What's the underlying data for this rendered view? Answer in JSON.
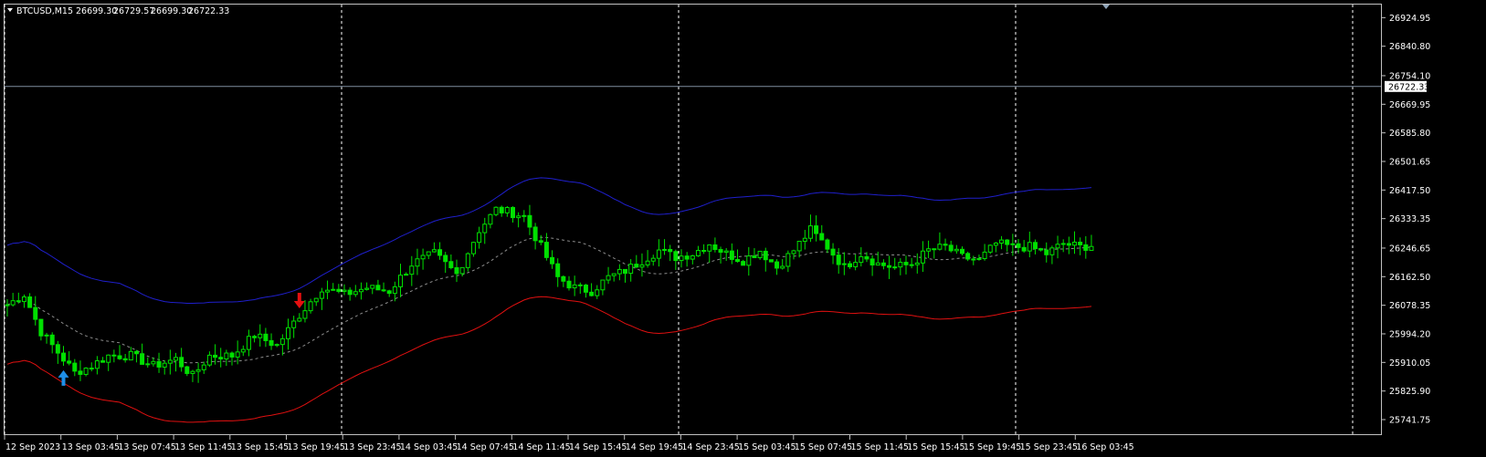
{
  "header": {
    "symbol": "BTCUSD,M15",
    "open": "26699.30",
    "high": "26729.57",
    "low": "26699.30",
    "close": "26722.33"
  },
  "colors": {
    "background": "#000000",
    "bull_candle": "#00e000",
    "bear_candle": "#00e000",
    "band_upper": "#1f1fcc",
    "band_middle": "#8c8c8c",
    "band_lower": "#e01010",
    "sell_arrow": "#e41010",
    "buy_arrow": "#1e8fe8",
    "price_line": "#7f8ea0",
    "grid": "#ffffff"
  },
  "chart_data": {
    "type": "candlestick",
    "symbol": "BTCUSD",
    "timeframe": "M15",
    "ylim": [
      25741.75,
      26950
    ],
    "y_ticks": [
      "26924.95",
      "26840.80",
      "26754.10",
      "26669.95",
      "26585.80",
      "26501.65",
      "26417.50",
      "26333.35",
      "26246.65",
      "26162.50",
      "26078.35",
      "25994.20",
      "25910.05",
      "25825.90",
      "25741.75"
    ],
    "x_ticks": [
      "12 Sep 2023",
      "13 Sep 03:45",
      "13 Sep 07:45",
      "13 Sep 11:45",
      "13 Sep 15:45",
      "13 Sep 19:45",
      "13 Sep 23:45",
      "14 Sep 03:45",
      "14 Sep 07:45",
      "14 Sep 11:45",
      "14 Sep 15:45",
      "14 Sep 19:45",
      "14 Sep 23:45",
      "15 Sep 03:45",
      "15 Sep 07:45",
      "15 Sep 11:45",
      "15 Sep 15:45",
      "15 Sep 19:45",
      "15 Sep 23:45",
      "16 Sep 03:45"
    ],
    "bar_count": 194,
    "day_separator_bars": [
      0,
      60,
      120,
      180,
      240
    ],
    "current_price": "26722.33",
    "close_anchors": [
      {
        "bar": 0,
        "price": 26080
      },
      {
        "bar": 3,
        "price": 26110
      },
      {
        "bar": 6,
        "price": 26000
      },
      {
        "bar": 9,
        "price": 25940
      },
      {
        "bar": 12,
        "price": 25880
      },
      {
        "bar": 15,
        "price": 25900
      },
      {
        "bar": 18,
        "price": 25930
      },
      {
        "bar": 22,
        "price": 25930
      },
      {
        "bar": 26,
        "price": 25900
      },
      {
        "bar": 30,
        "price": 25920
      },
      {
        "bar": 33,
        "price": 25870
      },
      {
        "bar": 36,
        "price": 25930
      },
      {
        "bar": 40,
        "price": 25930
      },
      {
        "bar": 44,
        "price": 25990
      },
      {
        "bar": 48,
        "price": 25960
      },
      {
        "bar": 52,
        "price": 26050
      },
      {
        "bar": 56,
        "price": 26130
      },
      {
        "bar": 60,
        "price": 26110
      },
      {
        "bar": 64,
        "price": 26130
      },
      {
        "bar": 68,
        "price": 26120
      },
      {
        "bar": 72,
        "price": 26200
      },
      {
        "bar": 76,
        "price": 26230
      },
      {
        "bar": 80,
        "price": 26170
      },
      {
        "bar": 84,
        "price": 26300
      },
      {
        "bar": 87,
        "price": 26360
      },
      {
        "bar": 90,
        "price": 26350
      },
      {
        "bar": 92,
        "price": 26340
      },
      {
        "bar": 95,
        "price": 26250
      },
      {
        "bar": 98,
        "price": 26160
      },
      {
        "bar": 101,
        "price": 26130
      },
      {
        "bar": 104,
        "price": 26120
      },
      {
        "bar": 107,
        "price": 26160
      },
      {
        "bar": 110,
        "price": 26180
      },
      {
        "bar": 113,
        "price": 26210
      },
      {
        "bar": 116,
        "price": 26240
      },
      {
        "bar": 119,
        "price": 26220
      },
      {
        "bar": 122,
        "price": 26230
      },
      {
        "bar": 125,
        "price": 26260
      },
      {
        "bar": 128,
        "price": 26230
      },
      {
        "bar": 131,
        "price": 26210
      },
      {
        "bar": 134,
        "price": 26240
      },
      {
        "bar": 137,
        "price": 26190
      },
      {
        "bar": 140,
        "price": 26240
      },
      {
        "bar": 143,
        "price": 26300
      },
      {
        "bar": 146,
        "price": 26250
      },
      {
        "bar": 149,
        "price": 26190
      },
      {
        "bar": 152,
        "price": 26230
      },
      {
        "bar": 155,
        "price": 26200
      },
      {
        "bar": 158,
        "price": 26190
      },
      {
        "bar": 161,
        "price": 26200
      },
      {
        "bar": 164,
        "price": 26240
      },
      {
        "bar": 167,
        "price": 26250
      },
      {
        "bar": 170,
        "price": 26220
      },
      {
        "bar": 173,
        "price": 26210
      },
      {
        "bar": 176,
        "price": 26260
      },
      {
        "bar": 179,
        "price": 26250
      },
      {
        "bar": 182,
        "price": 26250
      },
      {
        "bar": 185,
        "price": 26230
      },
      {
        "bar": 188,
        "price": 26260
      },
      {
        "bar": 191,
        "price": 26250
      },
      {
        "bar": 193,
        "price": 26255
      }
    ],
    "signals": [
      {
        "bar": 10,
        "type": "buy"
      },
      {
        "bar": 52,
        "type": "sell"
      }
    ]
  }
}
